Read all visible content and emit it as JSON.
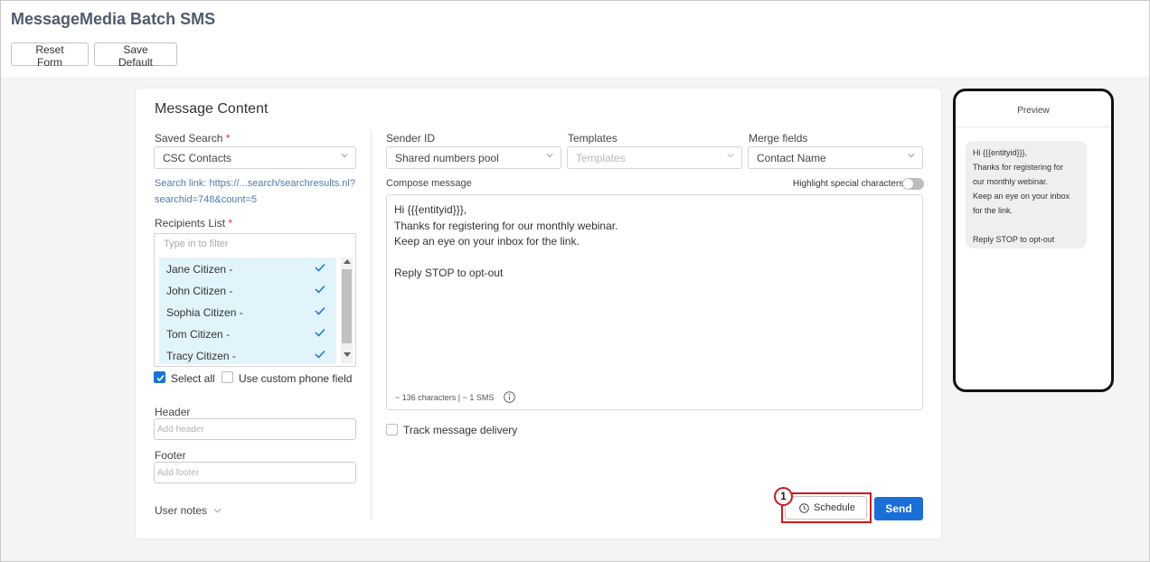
{
  "app": {
    "title": "MessageMedia Batch SMS"
  },
  "toolbar": {
    "reset_label": "Reset Form",
    "save_default_label": "Save Default"
  },
  "card": {
    "title": "Message Content"
  },
  "saved_search": {
    "label": "Saved Search",
    "required_mark": "*",
    "value": "CSC Contacts",
    "link_line1": "Search link: https://...search/searchresults.nl?",
    "link_line2": "searchid=748&count=5"
  },
  "recipients": {
    "label": "Recipients List",
    "required_mark": "*",
    "filter_placeholder": "Type in to filter",
    "items": [
      {
        "name": "Jane Citizen -",
        "checked": true
      },
      {
        "name": "John Citizen -",
        "checked": true
      },
      {
        "name": "Sophia Citizen -",
        "checked": true
      },
      {
        "name": "Tom Citizen -",
        "checked": true
      },
      {
        "name": "Tracy Citizen -",
        "checked": true
      }
    ],
    "select_all_label": "Select all",
    "select_all_checked": true,
    "custom_phone_label": "Use custom phone field",
    "custom_phone_checked": false
  },
  "header_field": {
    "label": "Header",
    "placeholder": "Add header"
  },
  "footer_field": {
    "label": "Footer",
    "placeholder": "Add footer"
  },
  "user_notes": {
    "label": "User notes"
  },
  "sender": {
    "label": "Sender ID",
    "value": "Shared numbers pool"
  },
  "templates": {
    "label": "Templates",
    "placeholder": "Templates"
  },
  "merge": {
    "label": "Merge fields",
    "value": "Contact Name"
  },
  "compose": {
    "label": "Compose message",
    "highlight_label": "Highlight special characters",
    "highlight_on": false,
    "text": "Hi {{{entityid}}},\nThanks for registering for our monthly webinar.\nKeep an eye on your inbox for the link.\n\nReply STOP to opt-out",
    "counter": "~ 136 characters | ~ 1 SMS"
  },
  "track": {
    "label": "Track message delivery",
    "checked": false
  },
  "actions": {
    "schedule_label": "Schedule",
    "send_label": "Send",
    "callout_number": "1"
  },
  "preview": {
    "title": "Preview",
    "bubble_text": "Hi {{{entityid}}},\nThanks for registering for\nour monthly webinar.\nKeep an eye on your inbox\nfor the link.\n\nReply STOP to opt-out"
  },
  "colors": {
    "accent": "#1a6ed8",
    "selected_row": "#e1f4fb",
    "callout": "#d0191b",
    "title": "#505a6e"
  }
}
